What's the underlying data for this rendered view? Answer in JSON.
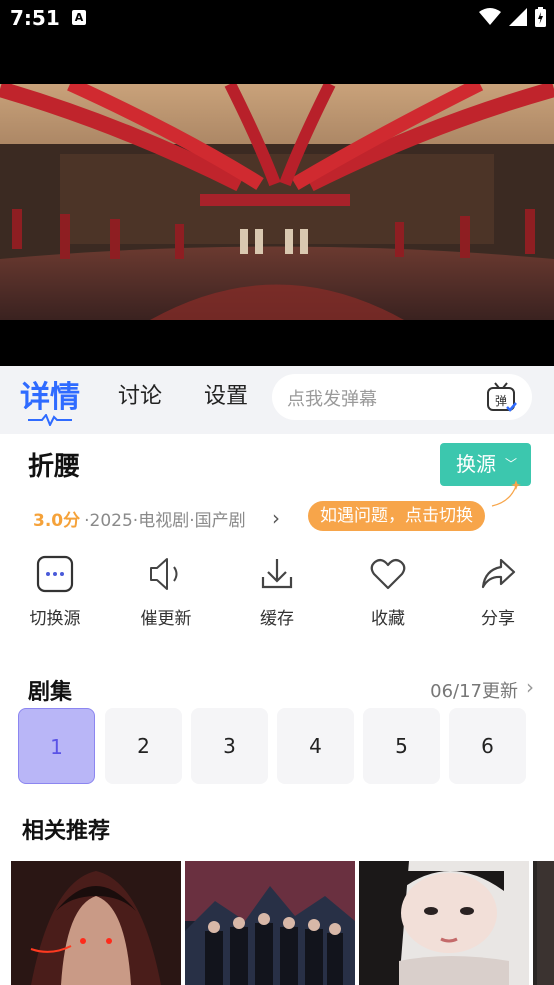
{
  "status": {
    "time": "7:51",
    "a_icon": "A"
  },
  "tabs": {
    "detail": "详情",
    "discuss": "讨论",
    "settings": "设置"
  },
  "danmu": {
    "placeholder": "点我发弹幕",
    "icon_char": "弹"
  },
  "show": {
    "title": "折腰",
    "score": "3.0分",
    "meta": "·2025·电视剧·国产剧",
    "source_button": "换源",
    "tip": "如遇问题，点击切换"
  },
  "actions": [
    {
      "label": "切换源",
      "icon": "dots-square-icon"
    },
    {
      "label": "催更新",
      "icon": "speaker-icon"
    },
    {
      "label": "缓存",
      "icon": "download-icon"
    },
    {
      "label": "收藏",
      "icon": "heart-icon"
    },
    {
      "label": "分享",
      "icon": "share-icon"
    }
  ],
  "episodes": {
    "title": "剧集",
    "update": "06/17更新",
    "items": [
      "1",
      "2",
      "3",
      "4",
      "5",
      "6"
    ],
    "selected": "1"
  },
  "related": {
    "title": "相关推荐"
  },
  "colors": {
    "accent": "#2f6bff",
    "source_button": "#3cc7ae",
    "tip": "#f7a54a",
    "score": "#f5a23a",
    "episode_selected": "#b9b6f7"
  }
}
